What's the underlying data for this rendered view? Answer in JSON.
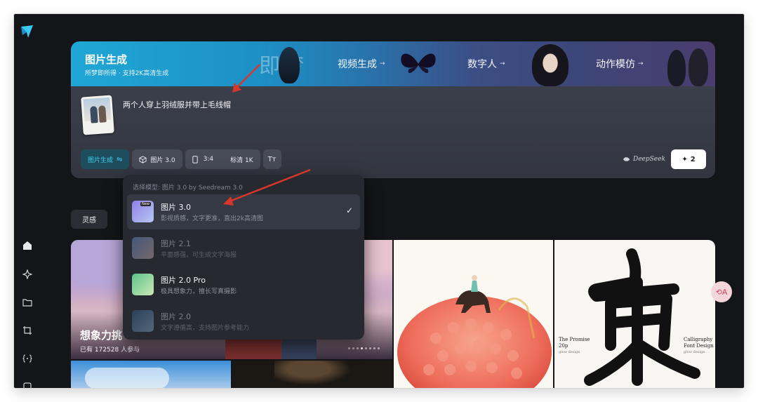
{
  "banner": {
    "image_gen": {
      "title": "图片生成",
      "subtitle": "所梦即所得 · 支持2K高清生成"
    },
    "decor_text": "即梦",
    "tabs": [
      {
        "label": "视频生成",
        "arrow": "→"
      },
      {
        "label": "数字人",
        "arrow": "→"
      },
      {
        "label": "动作模仿",
        "arrow": "→"
      }
    ]
  },
  "prompt": {
    "text": "两个人穿上羽绒服并带上毛线帽"
  },
  "toolbar": {
    "mode_label": "图片生成",
    "mode_icon": "⇋",
    "model_label": "图片 3.0",
    "ratio_label": "3:4",
    "quality_label": "标清 1K",
    "text_icon": "Tт",
    "deepseek_label": "DeepSeek",
    "generate_label": "2",
    "generate_icon": "✦"
  },
  "dropdown": {
    "header": "选择模型: 图片 3.0 by Seedream 3.0",
    "items": [
      {
        "name": "图片 3.0",
        "desc": "影视质感，文字更准，直出2k高清图",
        "badge": "New",
        "selected": true,
        "color_a": "#8f7fe6",
        "color_b": "#b6c8f4"
      },
      {
        "name": "图片 2.1",
        "desc": "平面感强，可生成文字海报",
        "selected": false,
        "color_a": "#6a8fd6",
        "color_b": "#d6b7b7"
      },
      {
        "name": "图片 2.0 Pro",
        "desc": "极具想象力，擅长写真摄影",
        "selected": false,
        "color_a": "#5ec28c",
        "color_b": "#cbe9b7"
      },
      {
        "name": "图片 2.0",
        "desc": "文字遵循高，支持图片参考能力",
        "selected": false,
        "color_a": "#2d5f8a",
        "color_b": "#8cb3d6"
      }
    ]
  },
  "inspiration_tab": "灵感",
  "gallery": {
    "feature": {
      "title": "想象力挑",
      "subtitle": "已有 172528 人参与"
    },
    "poster": {
      "glyphs": "東風",
      "left_title": "The Promise",
      "left_num": "20p",
      "left_small": "glow design",
      "right_title": "Calligraphy",
      "right_title2": "Font Design",
      "right_small": "glow design"
    }
  },
  "float_button_icon": "⟲A"
}
